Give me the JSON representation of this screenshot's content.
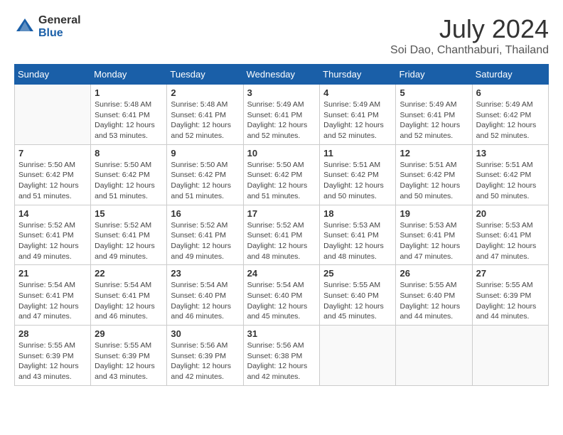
{
  "logo": {
    "general": "General",
    "blue": "Blue"
  },
  "title": {
    "month": "July 2024",
    "location": "Soi Dao, Chanthaburi, Thailand"
  },
  "headers": [
    "Sunday",
    "Monday",
    "Tuesday",
    "Wednesday",
    "Thursday",
    "Friday",
    "Saturday"
  ],
  "weeks": [
    [
      {
        "day": "",
        "info": ""
      },
      {
        "day": "1",
        "info": "Sunrise: 5:48 AM\nSunset: 6:41 PM\nDaylight: 12 hours\nand 53 minutes."
      },
      {
        "day": "2",
        "info": "Sunrise: 5:48 AM\nSunset: 6:41 PM\nDaylight: 12 hours\nand 52 minutes."
      },
      {
        "day": "3",
        "info": "Sunrise: 5:49 AM\nSunset: 6:41 PM\nDaylight: 12 hours\nand 52 minutes."
      },
      {
        "day": "4",
        "info": "Sunrise: 5:49 AM\nSunset: 6:41 PM\nDaylight: 12 hours\nand 52 minutes."
      },
      {
        "day": "5",
        "info": "Sunrise: 5:49 AM\nSunset: 6:41 PM\nDaylight: 12 hours\nand 52 minutes."
      },
      {
        "day": "6",
        "info": "Sunrise: 5:49 AM\nSunset: 6:42 PM\nDaylight: 12 hours\nand 52 minutes."
      }
    ],
    [
      {
        "day": "7",
        "info": "Sunrise: 5:50 AM\nSunset: 6:42 PM\nDaylight: 12 hours\nand 51 minutes."
      },
      {
        "day": "8",
        "info": "Sunrise: 5:50 AM\nSunset: 6:42 PM\nDaylight: 12 hours\nand 51 minutes."
      },
      {
        "day": "9",
        "info": "Sunrise: 5:50 AM\nSunset: 6:42 PM\nDaylight: 12 hours\nand 51 minutes."
      },
      {
        "day": "10",
        "info": "Sunrise: 5:50 AM\nSunset: 6:42 PM\nDaylight: 12 hours\nand 51 minutes."
      },
      {
        "day": "11",
        "info": "Sunrise: 5:51 AM\nSunset: 6:42 PM\nDaylight: 12 hours\nand 50 minutes."
      },
      {
        "day": "12",
        "info": "Sunrise: 5:51 AM\nSunset: 6:42 PM\nDaylight: 12 hours\nand 50 minutes."
      },
      {
        "day": "13",
        "info": "Sunrise: 5:51 AM\nSunset: 6:42 PM\nDaylight: 12 hours\nand 50 minutes."
      }
    ],
    [
      {
        "day": "14",
        "info": "Sunrise: 5:52 AM\nSunset: 6:41 PM\nDaylight: 12 hours\nand 49 minutes."
      },
      {
        "day": "15",
        "info": "Sunrise: 5:52 AM\nSunset: 6:41 PM\nDaylight: 12 hours\nand 49 minutes."
      },
      {
        "day": "16",
        "info": "Sunrise: 5:52 AM\nSunset: 6:41 PM\nDaylight: 12 hours\nand 49 minutes."
      },
      {
        "day": "17",
        "info": "Sunrise: 5:52 AM\nSunset: 6:41 PM\nDaylight: 12 hours\nand 48 minutes."
      },
      {
        "day": "18",
        "info": "Sunrise: 5:53 AM\nSunset: 6:41 PM\nDaylight: 12 hours\nand 48 minutes."
      },
      {
        "day": "19",
        "info": "Sunrise: 5:53 AM\nSunset: 6:41 PM\nDaylight: 12 hours\nand 47 minutes."
      },
      {
        "day": "20",
        "info": "Sunrise: 5:53 AM\nSunset: 6:41 PM\nDaylight: 12 hours\nand 47 minutes."
      }
    ],
    [
      {
        "day": "21",
        "info": "Sunrise: 5:54 AM\nSunset: 6:41 PM\nDaylight: 12 hours\nand 47 minutes."
      },
      {
        "day": "22",
        "info": "Sunrise: 5:54 AM\nSunset: 6:41 PM\nDaylight: 12 hours\nand 46 minutes."
      },
      {
        "day": "23",
        "info": "Sunrise: 5:54 AM\nSunset: 6:40 PM\nDaylight: 12 hours\nand 46 minutes."
      },
      {
        "day": "24",
        "info": "Sunrise: 5:54 AM\nSunset: 6:40 PM\nDaylight: 12 hours\nand 45 minutes."
      },
      {
        "day": "25",
        "info": "Sunrise: 5:55 AM\nSunset: 6:40 PM\nDaylight: 12 hours\nand 45 minutes."
      },
      {
        "day": "26",
        "info": "Sunrise: 5:55 AM\nSunset: 6:40 PM\nDaylight: 12 hours\nand 44 minutes."
      },
      {
        "day": "27",
        "info": "Sunrise: 5:55 AM\nSunset: 6:39 PM\nDaylight: 12 hours\nand 44 minutes."
      }
    ],
    [
      {
        "day": "28",
        "info": "Sunrise: 5:55 AM\nSunset: 6:39 PM\nDaylight: 12 hours\nand 43 minutes."
      },
      {
        "day": "29",
        "info": "Sunrise: 5:55 AM\nSunset: 6:39 PM\nDaylight: 12 hours\nand 43 minutes."
      },
      {
        "day": "30",
        "info": "Sunrise: 5:56 AM\nSunset: 6:39 PM\nDaylight: 12 hours\nand 42 minutes."
      },
      {
        "day": "31",
        "info": "Sunrise: 5:56 AM\nSunset: 6:38 PM\nDaylight: 12 hours\nand 42 minutes."
      },
      {
        "day": "",
        "info": ""
      },
      {
        "day": "",
        "info": ""
      },
      {
        "day": "",
        "info": ""
      }
    ]
  ]
}
